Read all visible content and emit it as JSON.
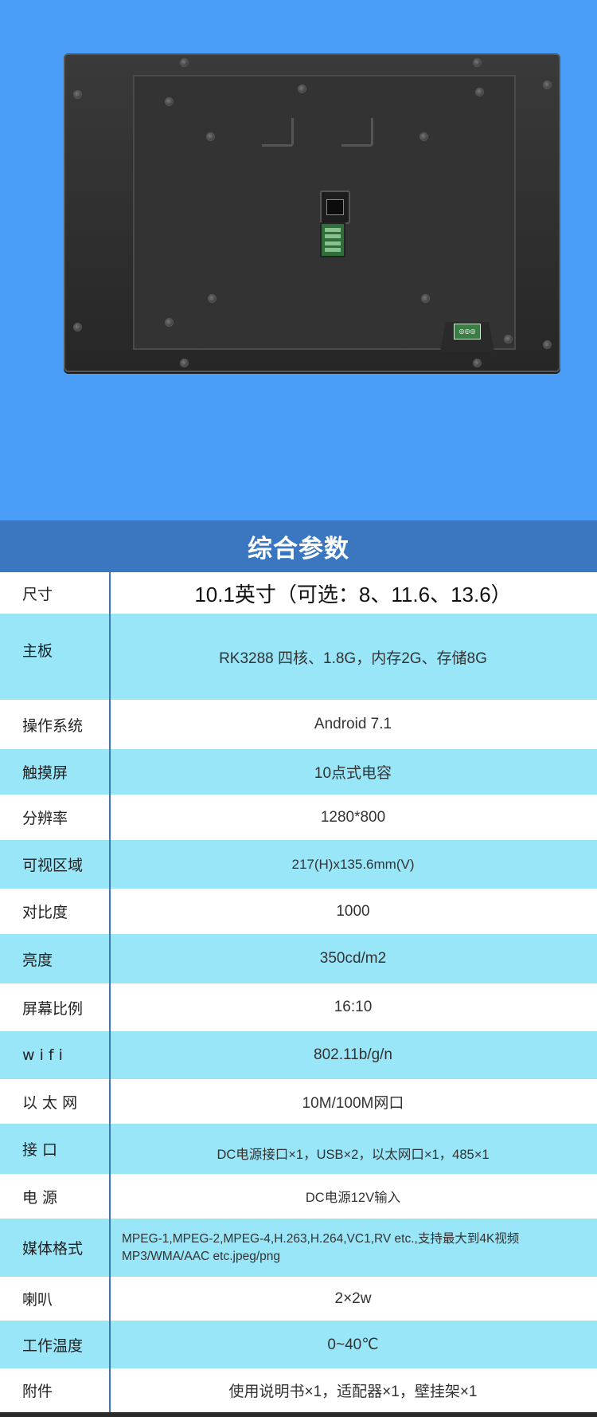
{
  "section_title": "综合参数",
  "colors": {
    "hero_bg": "#4a9ef7",
    "title_bar": "#3a77c0",
    "row_alt": "#99e6f9",
    "divider": "#3a77c0"
  },
  "device_image": {
    "icons": [
      "ethernet-port-icon",
      "terminal-block-icon",
      "power-connector-icon"
    ]
  },
  "specs": [
    {
      "label": "尺寸",
      "value": "10.1英寸（可选：8、11.6、13.6）"
    },
    {
      "label": "主板",
      "value": "RK3288 四核、1.8G，内存2G、存储8G"
    },
    {
      "label": "操作系统",
      "value": "Android 7.1"
    },
    {
      "label": "触摸屏",
      "value": "10点式电容"
    },
    {
      "label": "分辨率",
      "value": "1280*800"
    },
    {
      "label": "可视区域",
      "value": "217(H)x135.6mm(V)"
    },
    {
      "label": "对比度",
      "value": "1000"
    },
    {
      "label": "亮度",
      "value": "350cd/m2"
    },
    {
      "label": "屏幕比例",
      "value": "16:10"
    },
    {
      "label": "w i f i",
      "value": "802.11b/g/n"
    },
    {
      "label": "以 太 网",
      "value": "10M/100M网口"
    },
    {
      "label": "接 口",
      "value": "DC电源接口×1，USB×2，以太网口×1，485×1"
    },
    {
      "label": "电 源",
      "value": "DC电源12V输入"
    },
    {
      "label": "媒体格式",
      "value": "MPEG-1,MPEG-2,MPEG-4,H.263,H.264,VC1,RV etc.,支持最大到4K视频\nMP3/WMA/AAC etc.jpeg/png"
    },
    {
      "label": "喇叭",
      "value": "2×2w"
    },
    {
      "label": "工作温度",
      "value": "0~40℃"
    },
    {
      "label": "附件",
      "value": "使用说明书×1，适配器×1，壁挂架×1"
    }
  ]
}
